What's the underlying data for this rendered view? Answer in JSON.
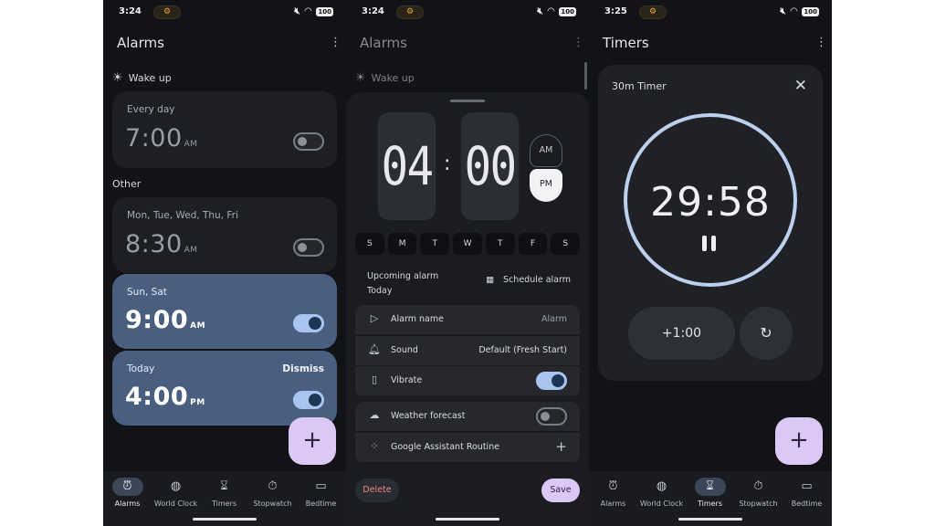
{
  "screen1": {
    "status": {
      "time": "3:24",
      "battery": "100"
    },
    "title": "Alarms",
    "wake_section": "Wake up",
    "other_section": "Other",
    "alarms": [
      {
        "days": "Every day",
        "time": "7:00",
        "ampm": "AM",
        "enabled": false
      },
      {
        "days": "Mon, Tue, Wed, Thu, Fri",
        "time": "8:30",
        "ampm": "AM",
        "enabled": false
      },
      {
        "days": "Sun, Sat",
        "time": "9:00",
        "ampm": "AM",
        "enabled": true
      },
      {
        "days": "Today",
        "time": "4:00",
        "ampm": "PM",
        "enabled": true,
        "action": "Dismiss"
      }
    ],
    "fab": "+"
  },
  "screen2": {
    "status": {
      "time": "3:24",
      "battery": "100"
    },
    "title": "Alarms",
    "wake_section": "Wake up",
    "picker": {
      "hour": "04",
      "minute": "00",
      "colon": ":",
      "am": "AM",
      "pm": "PM",
      "selected": "PM"
    },
    "weekdays": [
      "S",
      "M",
      "T",
      "W",
      "T",
      "F",
      "S"
    ],
    "upcoming_label": "Upcoming alarm",
    "upcoming_value": "Today",
    "schedule_label": "Schedule alarm",
    "settings": {
      "alarm_name_label": "Alarm name",
      "alarm_name_value": "Alarm",
      "sound_label": "Sound",
      "sound_value": "Default (Fresh Start)",
      "vibrate_label": "Vibrate",
      "vibrate_on": true,
      "weather_label": "Weather forecast",
      "weather_on": false,
      "assistant_label": "Google Assistant Routine",
      "assistant_add": "+"
    },
    "delete_label": "Delete",
    "save_label": "Save"
  },
  "screen3": {
    "status": {
      "time": "3:25",
      "battery": "100"
    },
    "title": "Timers",
    "timer_name": "30m Timer",
    "remaining": "29:58",
    "add_minute": "+1:00",
    "fab": "+"
  },
  "nav": {
    "alarms": "Alarms",
    "world_clock": "World Clock",
    "timers": "Timers",
    "stopwatch": "Stopwatch",
    "bedtime": "Bedtime"
  },
  "colors": {
    "background": "#121316",
    "card": "#1d1f25",
    "active_card": "#4a5f80",
    "accent_fab": "#dcc8f5",
    "toggle_on": "#a9c4ee",
    "ring": "#bcd0ee",
    "delete_text": "#f08a80"
  },
  "icons": [
    "alarm-clock-icon",
    "globe-icon",
    "hourglass-icon",
    "stopwatch-icon",
    "bed-icon",
    "sun-icon",
    "label-icon",
    "bell-icon",
    "vibrate-icon",
    "cloud-icon",
    "assistant-icon",
    "calendar-icon",
    "close-icon",
    "pause-icon",
    "reset-icon"
  ]
}
